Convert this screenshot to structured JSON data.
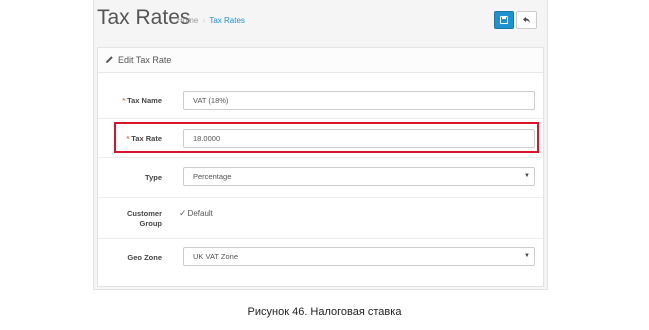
{
  "header": {
    "title": "Tax Rates",
    "breadcrumb": {
      "home": "Home",
      "separator": "›",
      "current": "Tax Rates"
    },
    "save_icon": "floppy-disk-icon",
    "back_icon": "reply-arrow-icon"
  },
  "panel": {
    "icon": "pencil-icon",
    "title": "Edit Tax Rate"
  },
  "form": {
    "required_mark": "*",
    "tax_name": {
      "label": "Tax Name",
      "value": "VAT (18%)"
    },
    "tax_rate": {
      "label": "Tax Rate",
      "value": "18.0000"
    },
    "type": {
      "label": "Type",
      "value": "Percentage"
    },
    "customer_group": {
      "label_line1": "Customer",
      "label_line2": "Group",
      "option": "Default",
      "checked": true
    },
    "geo_zone": {
      "label": "Geo Zone",
      "value": "UK VAT Zone"
    }
  },
  "caption": "Рисунок 46. Налоговая ставка",
  "colors": {
    "accent": "#1e91cf",
    "required": "#f56b6b",
    "highlight": "#d9142b"
  }
}
